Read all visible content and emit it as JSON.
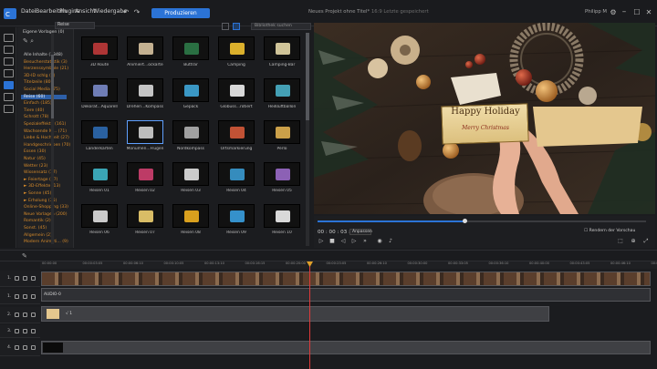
{
  "menu": [
    "Datei",
    "Bearbeiten",
    "Plugins",
    "Ansicht",
    "Wiedergabe"
  ],
  "produce_button": "Produzieren",
  "project_title": "Neues Projekt ohne Titel*",
  "project_subtitle": "16:9 Letzte gespeichert",
  "user": "Philipp M",
  "library": {
    "dropdown": "Reise",
    "search_placeholder": "Bibliothek suchen",
    "tiles": [
      [
        "3D Route",
        "Animiert...ockarte",
        "Buttrar",
        "Camping",
        "Camping-Bar"
      ],
      [
        "Dekorat...Aquarell",
        "Dreheri...Kompass",
        "Gepäck",
        "Globuss...rotiert",
        "Heißluftballon"
      ],
      [
        "Länderkarten",
        "Monumen...Flügen",
        "Nordkompass",
        "Ortsmarkierung",
        "Perlo"
      ],
      [
        "Reisen 01",
        "Reisen 02",
        "Reisen 03",
        "Reisen 04",
        "Reisen 05"
      ],
      [
        "Reisen 06",
        "Reisen 07",
        "Reisen 08",
        "Reisen 09",
        "Reisen 10"
      ]
    ]
  },
  "categories": {
    "header": "Eigene Vorlagen (0)",
    "items": [
      {
        "label": "Alle Inhalte (1348)",
        "style": "white"
      },
      {
        "label": "Besucherstatistik (3)",
        "style": "orange"
      },
      {
        "label": "Herzenssymbole (21)",
        "style": "orange"
      },
      {
        "label": "3D-ID schlg (3)",
        "style": "orange"
      },
      {
        "label": "Titelzeile (80)",
        "style": "orange"
      },
      {
        "label": "Social Media (75)",
        "style": "orange"
      },
      {
        "label": "Reise (60)",
        "style": "selected"
      },
      {
        "label": "Einfach (185)",
        "style": "orange"
      },
      {
        "label": "Tiere (40)",
        "style": "orange"
      },
      {
        "label": "Schrott (78)",
        "style": "orange"
      },
      {
        "label": "Spezialeffekte (161)",
        "style": "orange"
      },
      {
        "label": "Wachsende M... (71)",
        "style": "orange"
      },
      {
        "label": "Liebe & Hochzeit (27)",
        "style": "orange"
      },
      {
        "label": "Handgeschrieben (70)",
        "style": "orange"
      },
      {
        "label": "Essen (30)",
        "style": "orange"
      },
      {
        "label": "Natur (45)",
        "style": "orange"
      },
      {
        "label": "Wetter (23)",
        "style": "orange"
      },
      {
        "label": "Wissensatz (17)",
        "style": "orange"
      },
      {
        "label": "► Feiertage (37)",
        "style": "orange"
      },
      {
        "label": "► 3D-Effekte (13)",
        "style": "orange"
      },
      {
        "label": "► Sonne (45)",
        "style": "orange"
      },
      {
        "label": "► Erholung (35)",
        "style": "orange"
      },
      {
        "label": "Online-Shopping (33)",
        "style": "orange"
      },
      {
        "label": "Neue Vorlagen (200)",
        "style": "orange"
      },
      {
        "label": "Romantik (2)",
        "style": "orange"
      },
      {
        "label": "Sonst. (45)",
        "style": "orange"
      },
      {
        "label": "Allgemein (2)",
        "style": "orange"
      },
      {
        "label": "Modern Animati... (9)",
        "style": "orange"
      }
    ]
  },
  "preview": {
    "title_line1": "Happy Holiday",
    "title_line2": "Merry Christmas",
    "timecode": "00 : 00 : 03 : 13",
    "quality": "Anpassen",
    "render_label": "Rendern der Vorschau"
  },
  "timeline": {
    "ticks": [
      "00:00:00",
      "00:00:03:05",
      "00:00:06:10",
      "00:00:10:05",
      "00:00:13:10",
      "00:00:16:15",
      "00:00:20:00",
      "00:00:23:05",
      "00:00:26:10",
      "00:00:30:00",
      "00:00:33:05",
      "00:00:36:10",
      "00:00:40:00",
      "00:00:43:05",
      "00:00:46:10",
      "00:00:50:00"
    ],
    "tracks": [
      "1.",
      "1.",
      "2.",
      "3.",
      "4."
    ],
    "clip_label": "AUDIO-0",
    "title_clip_label": "√ 1"
  }
}
